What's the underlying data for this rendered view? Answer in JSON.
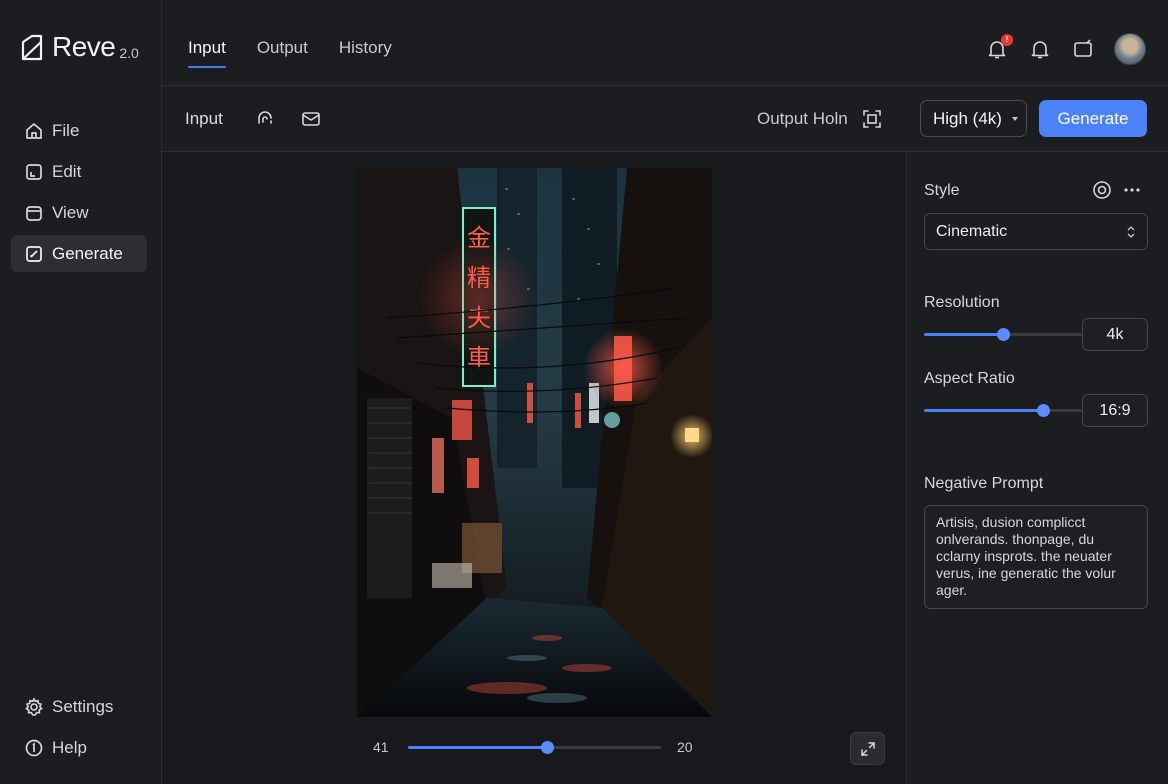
{
  "app": {
    "name": "Reve",
    "version": "2.0"
  },
  "sidebar": {
    "items": [
      {
        "label": "File",
        "icon": "home-icon"
      },
      {
        "label": "Edit",
        "icon": "edit-icon"
      },
      {
        "label": "View",
        "icon": "view-icon"
      },
      {
        "label": "Generate",
        "icon": "generate-icon",
        "active": true
      }
    ],
    "bottom": [
      {
        "label": "Settings",
        "icon": "gear-icon"
      },
      {
        "label": "Help",
        "icon": "help-icon"
      }
    ]
  },
  "tabs": [
    {
      "label": "Input",
      "active": true
    },
    {
      "label": "Output"
    },
    {
      "label": "History"
    }
  ],
  "topbar": {
    "notification_badge": "!"
  },
  "toolbar": {
    "input_label": "Input",
    "output_hold_label": "Output Holn",
    "quality_value": "High (4k)",
    "generate_label": "Generate"
  },
  "canvas": {
    "image_description_signs": [
      "金",
      "精",
      "夫",
      "車"
    ],
    "zoom": {
      "min_label": "41",
      "max_label": "20",
      "fraction": 0.55
    }
  },
  "panel": {
    "style": {
      "label": "Style",
      "value": "Cinematic"
    },
    "resolution": {
      "label": "Resolution",
      "value": "4k",
      "fraction": 0.5
    },
    "aspect_ratio": {
      "label": "Aspect Ratio",
      "value": "16:9",
      "fraction": 0.75
    },
    "negative_prompt": {
      "label": "Negative Prompt",
      "text": "Artisis, dusion complicct onlverands. thonpage, du cclarny insprots. the neuater verus, ine generatic the volur ager."
    }
  },
  "colors": {
    "accent": "#4c82f7",
    "badge": "#e53935",
    "background": "#1b1c1f"
  }
}
